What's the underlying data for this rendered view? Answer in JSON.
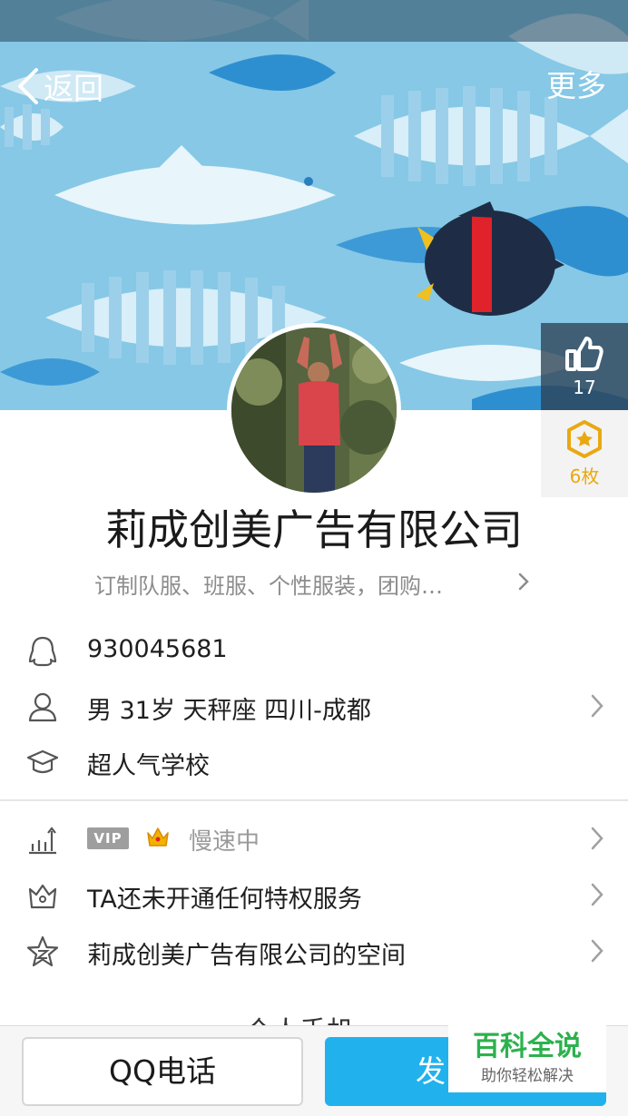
{
  "nav": {
    "back_label": "返回",
    "more_label": "更多"
  },
  "like": {
    "count": "17"
  },
  "medal": {
    "count": "6枚"
  },
  "profile": {
    "name": "莉成创美广告有限公司",
    "signature": "订制队服、班服、个性服装，团购…"
  },
  "info": {
    "qq_number": "930045681",
    "personal": "男  31岁  天秤座  四川-成都",
    "school": "超人气学校"
  },
  "services": {
    "vip_tag": "VIP",
    "vip_status": "慢速中",
    "privilege": "TA还未开通任何特权服务",
    "space": "莉成创美广告有限公司的空间"
  },
  "section_peek": "个人手机",
  "bottom": {
    "call_label": "QQ电话",
    "message_label": "发"
  },
  "watermark": {
    "title": "百科全说",
    "subtitle": "助你轻松解决"
  },
  "colors": {
    "accent": "#21b2ee",
    "medal": "#e9a812",
    "cover_bg": "#86c8e6",
    "watermark_green": "#2db14e"
  }
}
